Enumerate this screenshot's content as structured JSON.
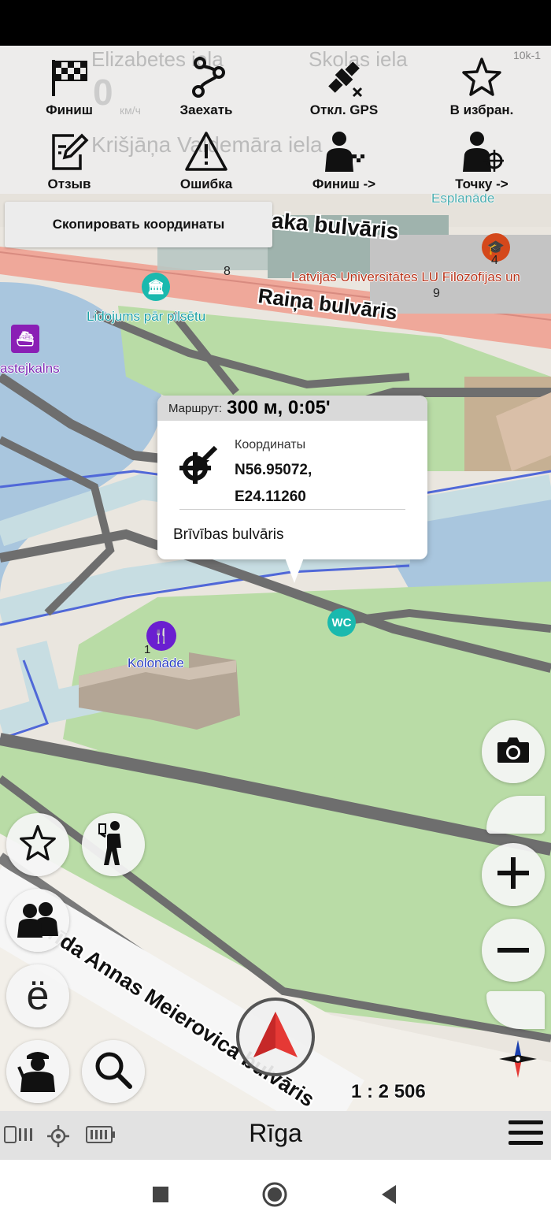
{
  "quick_actions": [
    {
      "id": "finish",
      "label": "Финиш",
      "icon": "checkered-flag-icon"
    },
    {
      "id": "drive-through",
      "label": "Заехать",
      "icon": "route-waypoint-icon"
    },
    {
      "id": "gps-off",
      "label": "Откл. GPS",
      "icon": "satellite-off-icon"
    },
    {
      "id": "favorites",
      "label": "В избран.",
      "icon": "star-icon"
    },
    {
      "id": "feedback",
      "label": "Отзыв",
      "icon": "edit-note-icon"
    },
    {
      "id": "error",
      "label": "Ошибка",
      "icon": "warning-icon"
    },
    {
      "id": "finish-to",
      "label": "Финиш ->",
      "icon": "person-flag-icon"
    },
    {
      "id": "point-to",
      "label": "Точку ->",
      "icon": "person-target-icon"
    }
  ],
  "copy_coordinates_label": "Скопировать координаты",
  "popup": {
    "route_label": "Маршрут:",
    "route_value": "300 м, 0:05'",
    "coordinates_title": "Координаты",
    "latitude": "N56.95072,",
    "longitude": "E24.11260",
    "street": "Brīvības bulvāris"
  },
  "map_labels": {
    "street_top_1": "aka bulvāris",
    "street_top_2": "Raiņa bulvāris",
    "street_bottom": "Frīda Annas Meierovica bulvāris",
    "poi_university": "Latvijas Universitātes LU Filozofijas un",
    "poi_esplanade": "Esplanāde",
    "poi_lidojums": "Lidojums pār pilsētu",
    "poi_bastejkalns": "astejkalns",
    "poi_kolonade": "Kolonāde",
    "poi_wc": "WC",
    "house_8": "8",
    "house_9": "9",
    "house_4": "4",
    "house_1": "1"
  },
  "faded_map_text": {
    "street_a": "Elizabetes iela",
    "street_b": "Skolas iela",
    "street_c": "Krišjāņa Valdemāra iela",
    "speed_value": "0",
    "speed_unit": "км/ч",
    "distance": "10k-1"
  },
  "scale": "1 : 2 506",
  "city": "Rīga",
  "colors": {
    "park_green": "#b9dca6",
    "water_blue": "#a9c6de",
    "road_gray": "#6e6e6e",
    "compass_red": "#e53935",
    "poi_teal": "#1ab9ae",
    "poi_purple": "#6a1fd0",
    "poi_orange": "#d4481b"
  }
}
